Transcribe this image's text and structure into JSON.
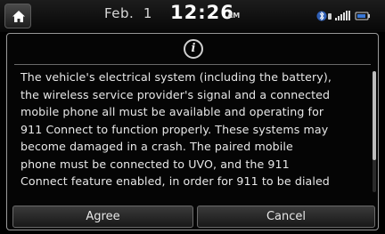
{
  "status_bar": {
    "date": "Feb.  1",
    "time": "12:26",
    "ampm": "AM",
    "icons": [
      "home-icon",
      "bluetooth-phone-icon",
      "signal-strength-icon",
      "battery-icon"
    ]
  },
  "dialog": {
    "icon": "info-icon",
    "message": "The vehicle's electrical system (including the battery),\nthe wireless service provider's signal and a connected\nmobile phone all must be available and operating for\n911 Connect to function properly. These systems may\nbecome damaged in a crash. The paired mobile\nphone must be connected to UVO, and the 911\nConnect feature enabled, in order for 911 to be dialed",
    "buttons": {
      "agree": "Agree",
      "cancel": "Cancel"
    }
  },
  "colors": {
    "background": "#000000",
    "text": "#e8e8e8",
    "border": "#9a9a9a"
  }
}
